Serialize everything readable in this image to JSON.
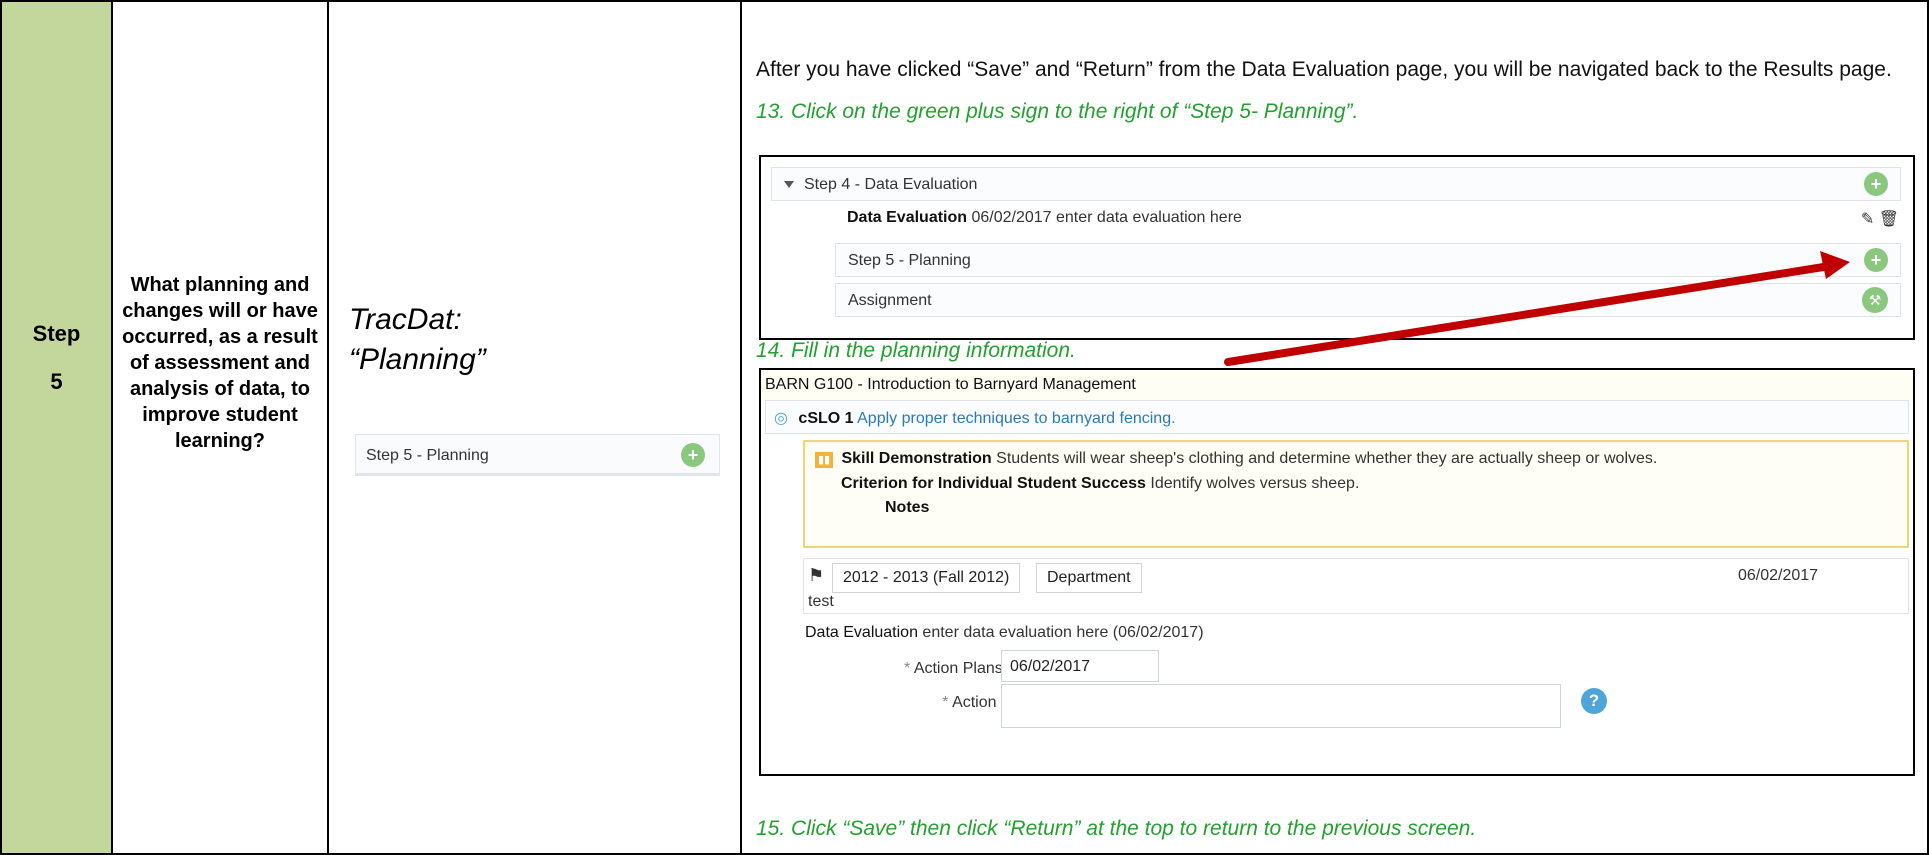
{
  "step": {
    "word": "Step",
    "number": "5"
  },
  "question": "What planning and changes will or have occurred, as a result of assessment and analysis of data, to improve student learning?",
  "tool": {
    "title_line1": "TracDat:",
    "title_line2": "“Planning”",
    "mini_row_label": "Step 5 - Planning"
  },
  "main": {
    "intro": "After you have clicked “Save” and “Return” from the Data Evaluation page, you will be navigated back to the Results page.",
    "instruction_13": "13. Click on the green plus sign to the right of “Step 5- Planning”.",
    "instruction_14": "14. Fill in the planning information.",
    "instruction_15": "15. Click “Save” then click “Return” at the top to return to the previous screen."
  },
  "shot1": {
    "step4_label": "Step 4 - Data Evaluation",
    "data_eval_label": "Data Evaluation",
    "data_eval_text": "06/02/2017 enter data evaluation here",
    "step5_label": "Step 5 - Planning",
    "assignment_label": "Assignment"
  },
  "shot2": {
    "course_title": "BARN G100 - Introduction to Barnyard Management",
    "slo_code": "cSLO 1",
    "slo_text": "Apply proper techniques to barnyard fencing.",
    "skill_label": "Skill Demonstration",
    "skill_text": "Students will wear sheep's clothing and determine whether they are actually sheep or wolves.",
    "criterion_label": "Criterion for Individual Student Success",
    "criterion_text": "Identify wolves versus sheep.",
    "notes_label": "Notes",
    "term_value": "2012 - 2013 (Fall 2012)",
    "dept_value": "Department",
    "result_date": "06/02/2017",
    "result_text": "test",
    "data_eval_label": "Data Evaluation",
    "data_eval_text": "enter data evaluation here (06/02/2017)",
    "action_date_label": "Action Plans Date",
    "action_date_value": "06/02/2017",
    "action_plans_label": "Action Plans",
    "required_mark": "*",
    "help_symbol": "?"
  },
  "icons": {
    "plus": "plus-circle-icon",
    "wrench": "wrench-icon",
    "edit": "edit-icon",
    "trash": "trash-icon",
    "flag": "flag-icon",
    "target": "target-icon",
    "chart": "bar-chart-icon",
    "arrow": "red-arrow"
  },
  "colors": {
    "step_cell": "#c3d69b",
    "instruction_text": "#22a12e",
    "plus_icon": "#8cc77f",
    "arrow": "#c00000",
    "link": "#2a7ab8",
    "help_icon": "#4ea6d8",
    "assessment_border": "#f1d57a"
  }
}
